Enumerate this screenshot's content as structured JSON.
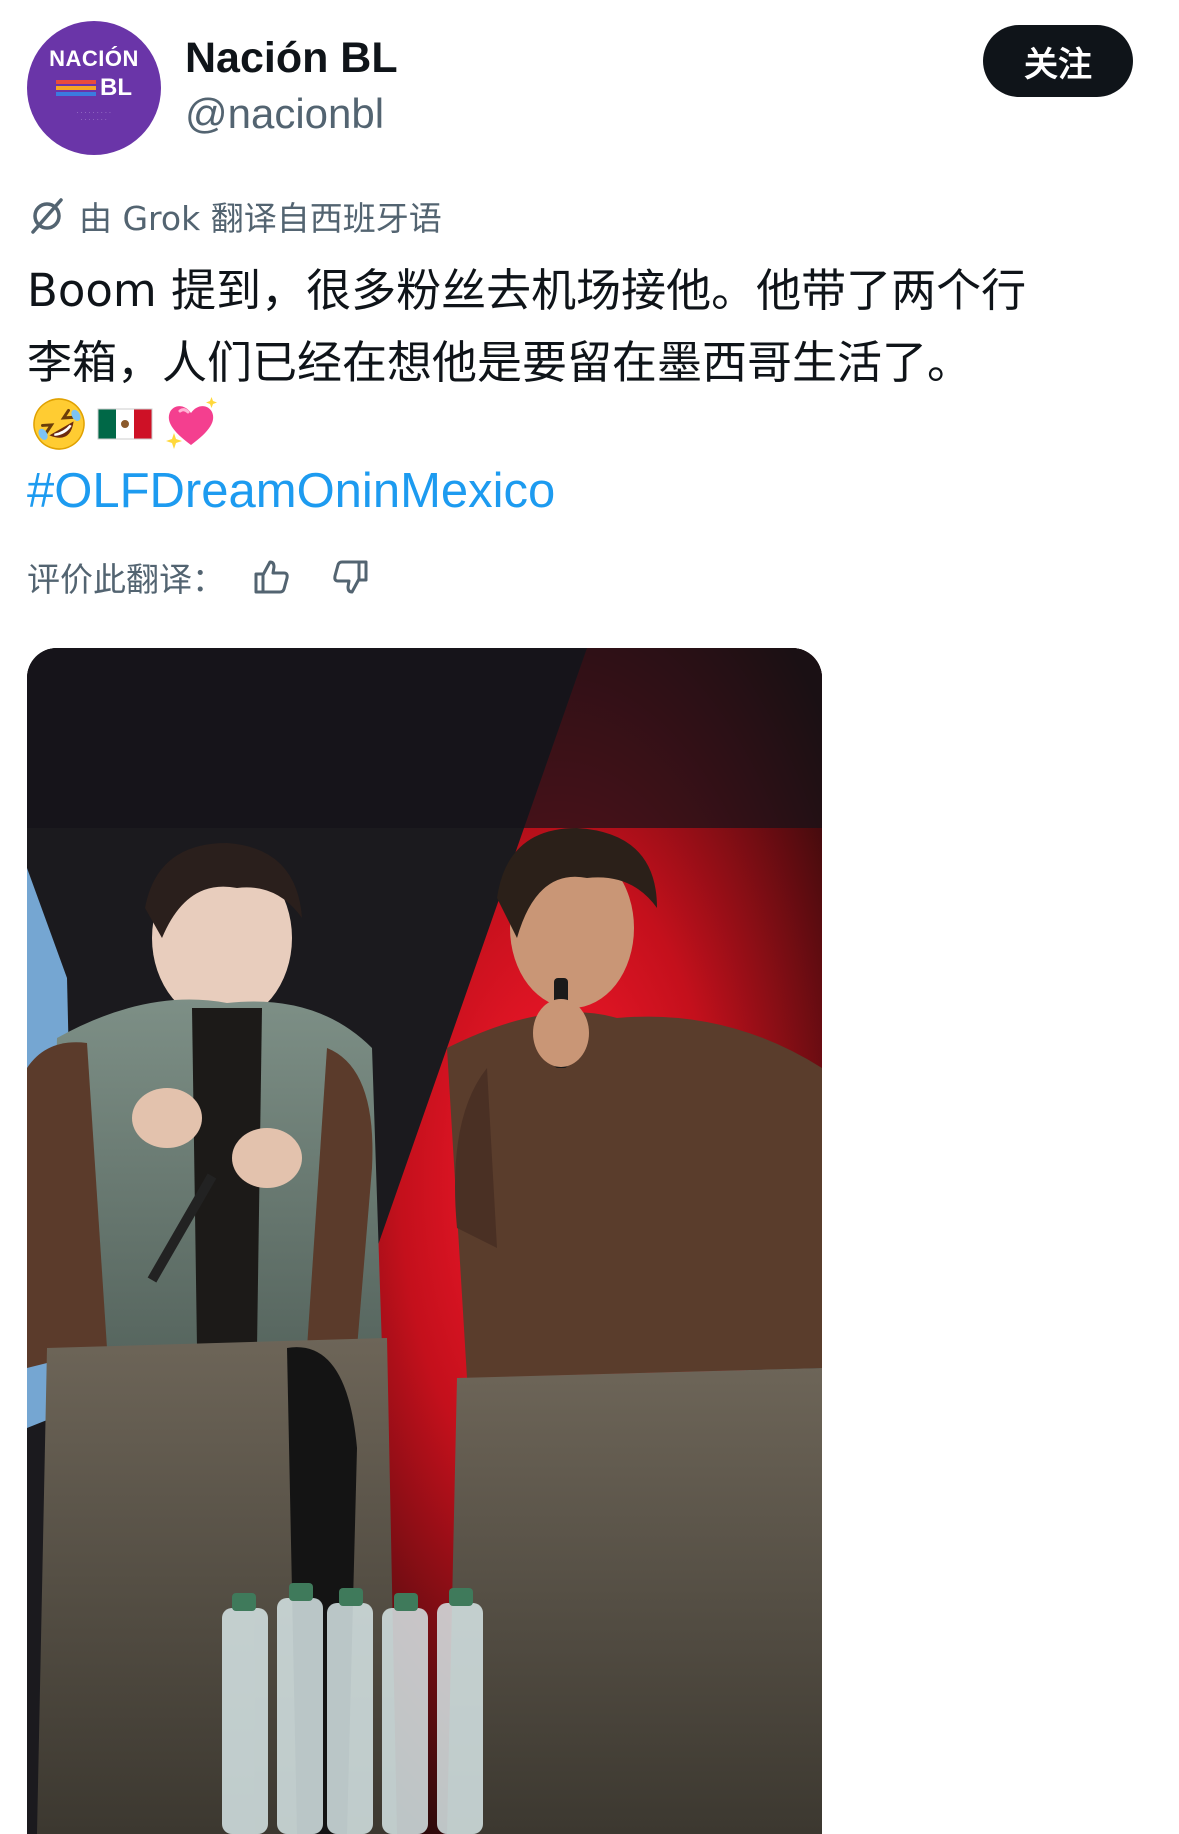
{
  "author": {
    "display_name": "Nación BL",
    "handle": "@nacionbl",
    "avatar_text_top": "NACIÓN",
    "avatar_text_bottom": "BL",
    "avatar_color": "#6a35a8"
  },
  "follow_button": {
    "label": "关注"
  },
  "translation": {
    "note": "由 Grok 翻译自西班牙语",
    "icon": "grok-icon"
  },
  "tweet": {
    "text_lines": [
      "Boom 提到，很多粉丝去机场接他。他带了两个行",
      "李箱，人们已经在想他是要留在墨西哥生活了。"
    ],
    "emojis": [
      "rolling-on-floor-laughing-emoji",
      "mexico-flag-emoji",
      "sparkling-heart-emoji"
    ],
    "hashtag": "#OLFDreamOninMexico"
  },
  "rate_translation": {
    "label": "评价此翻译：",
    "thumbs_up_icon": "thumbs-up-icon",
    "thumbs_down_icon": "thumbs-down-icon"
  },
  "media": {
    "type": "photo"
  },
  "colors": {
    "text": "#0f1419",
    "secondary": "#536471",
    "link": "#1d9bf0",
    "button_bg": "#0f1419"
  }
}
